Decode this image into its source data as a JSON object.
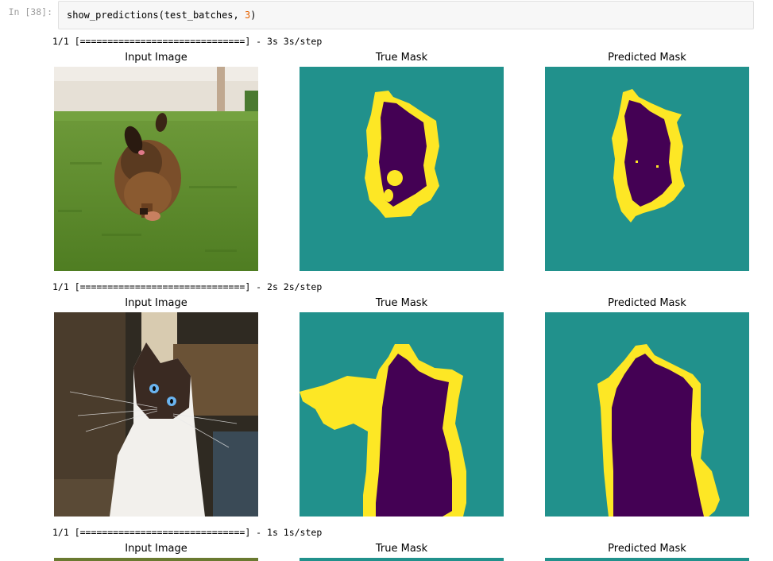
{
  "cell": {
    "prompt": "In [38]:",
    "code_fn": "show_predictions(test_batches, ",
    "code_arg": "3",
    "code_close": ")"
  },
  "rows": [
    {
      "progress": "1/1 [==============================] - 3s 3s/step",
      "titles": [
        "Input Image",
        "True Mask",
        "Predicted Mask"
      ],
      "input_subject": "dog running on grass",
      "input_icon": "dog-photo"
    },
    {
      "progress": "1/1 [==============================] - 2s 2s/step",
      "titles": [
        "Input Image",
        "True Mask",
        "Predicted Mask"
      ],
      "input_subject": "siamese cat looking up",
      "input_icon": "cat-photo"
    },
    {
      "progress": "1/1 [==============================] - 1s 1s/step",
      "titles": [
        "Input Image",
        "True Mask",
        "Predicted Mask"
      ]
    }
  ],
  "colors": {
    "mask_background": "#21918c",
    "mask_foreground": "#440154",
    "mask_border": "#fde725",
    "number_literal": "#e66200"
  }
}
